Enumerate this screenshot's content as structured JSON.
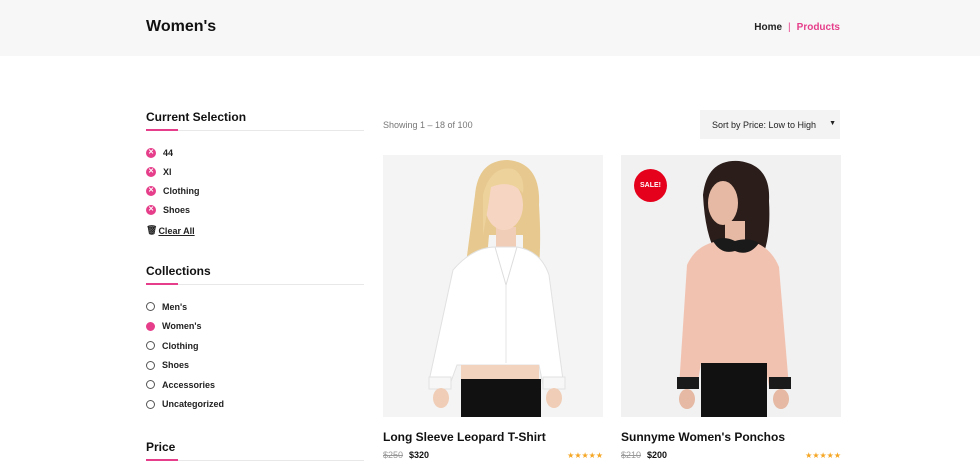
{
  "header": {
    "title": "Women's"
  },
  "breadcrumb": {
    "home": "Home",
    "separator": "|",
    "current": "Products"
  },
  "sidebar": {
    "current_selection": {
      "title": "Current Selection",
      "items": [
        "44",
        "Xl",
        "Clothing",
        "Shoes"
      ],
      "clear_all": "Clear All"
    },
    "collections": {
      "title": "Collections",
      "items": [
        "Men's",
        "Women's",
        "Clothing",
        "Shoes",
        "Accessories",
        "Uncategorized"
      ],
      "selected": "Women's"
    },
    "price": {
      "title": "Price"
    }
  },
  "toolbar": {
    "result_count": "Showing 1 – 18 of 100",
    "sort_value": "Sort by Price: Low to High"
  },
  "products": [
    {
      "name": "Long Sleeve Leopard T-Shirt",
      "old_price": "$250",
      "price": "$320",
      "stars": "★★★★★",
      "rating": 5,
      "sale": ""
    },
    {
      "name": "Sunnyme Women's Ponchos",
      "old_price": "$210",
      "price": "$200",
      "stars": "★★★★★",
      "rating": 5,
      "sale": "SALE!"
    }
  ],
  "colors": {
    "accent": "#e63e8a",
    "sale": "#e5001c",
    "star": "#f5a623",
    "header_bg": "#f7f7f7"
  }
}
